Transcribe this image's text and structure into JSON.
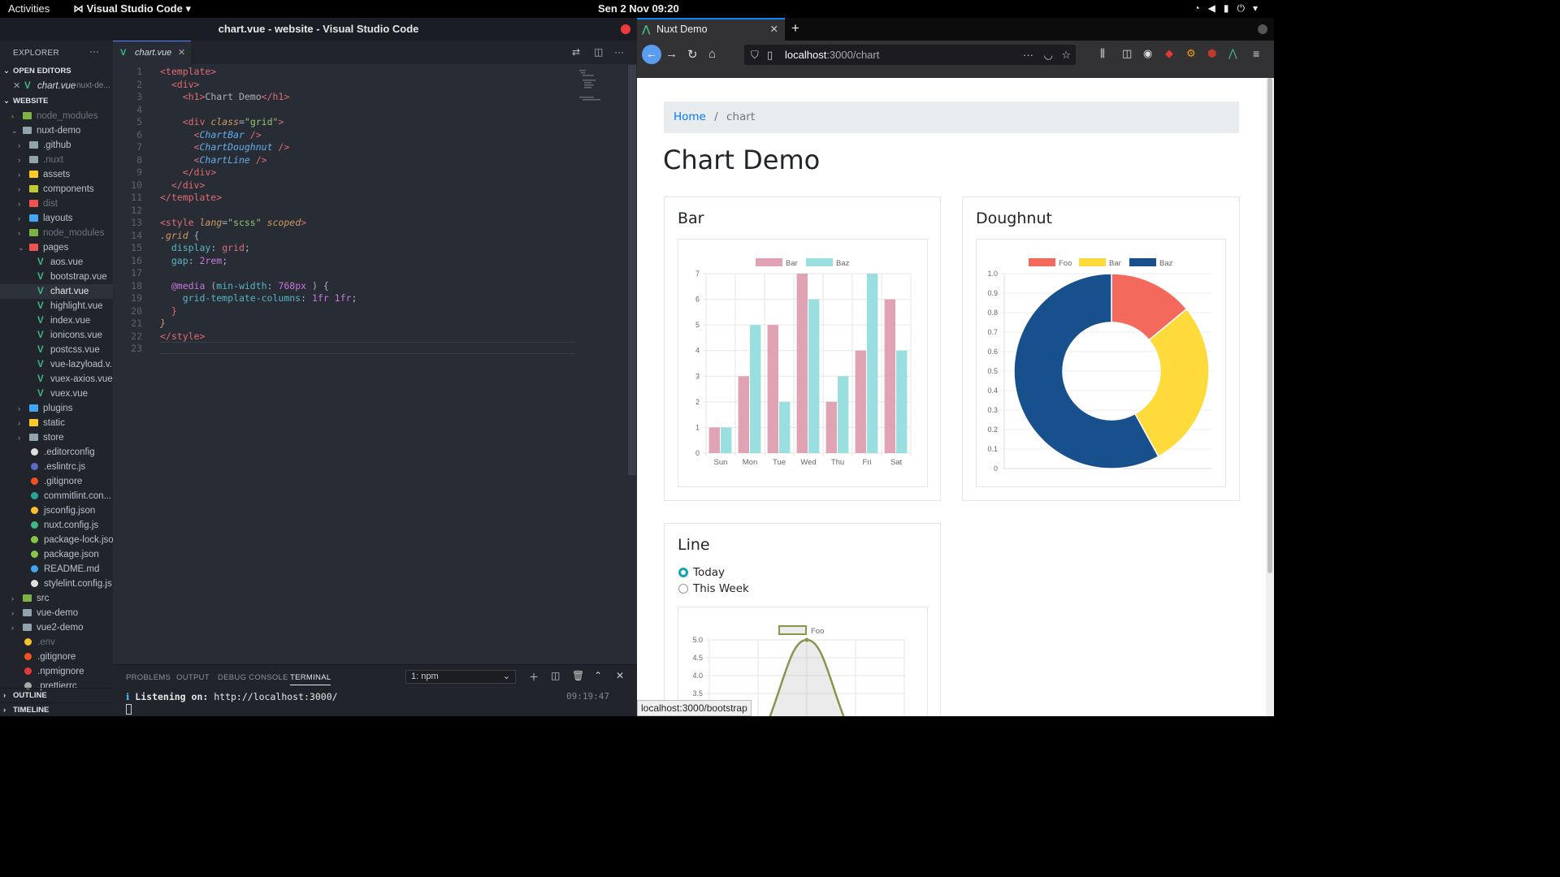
{
  "topbar": {
    "activities": "Activities",
    "app": "Visual Studio Code",
    "clock": "Sen  2 Nov  09:20"
  },
  "vscode": {
    "title": "chart.vue - website - Visual Studio Code",
    "explorer_label": "EXPLORER",
    "open_editors_label": "OPEN EDITORS",
    "open_editor": {
      "name": "chart.vue",
      "folder": "nuxt-de..."
    },
    "website_label": "WEBSITE",
    "outline_label": "OUTLINE",
    "timeline_label": "TIMELINE",
    "tree": [
      {
        "label": "node_modules",
        "depth": 1,
        "kind": "folder",
        "color": "#7cb342",
        "muted": true
      },
      {
        "label": "nuxt-demo",
        "depth": 1,
        "kind": "folder-open",
        "color": "#90a4ae"
      },
      {
        "label": ".github",
        "depth": 2,
        "kind": "folder",
        "color": "#90a4ae"
      },
      {
        "label": ".nuxt",
        "depth": 2,
        "kind": "folder",
        "color": "#90a4ae",
        "muted": true
      },
      {
        "label": "assets",
        "depth": 2,
        "kind": "folder",
        "color": "#ffca28"
      },
      {
        "label": "components",
        "depth": 2,
        "kind": "folder",
        "color": "#c0ca33"
      },
      {
        "label": "dist",
        "depth": 2,
        "kind": "folder",
        "color": "#ef5350",
        "muted": true
      },
      {
        "label": "layouts",
        "depth": 2,
        "kind": "folder",
        "color": "#42a5f5"
      },
      {
        "label": "node_modules",
        "depth": 2,
        "kind": "folder",
        "color": "#7cb342",
        "muted": true
      },
      {
        "label": "pages",
        "depth": 2,
        "kind": "folder-open",
        "color": "#ef5350"
      },
      {
        "label": "aos.vue",
        "depth": 3,
        "kind": "vue"
      },
      {
        "label": "bootstrap.vue",
        "depth": 3,
        "kind": "vue"
      },
      {
        "label": "chart.vue",
        "depth": 3,
        "kind": "vue",
        "selected": true
      },
      {
        "label": "highlight.vue",
        "depth": 3,
        "kind": "vue"
      },
      {
        "label": "index.vue",
        "depth": 3,
        "kind": "vue"
      },
      {
        "label": "ionicons.vue",
        "depth": 3,
        "kind": "vue"
      },
      {
        "label": "postcss.vue",
        "depth": 3,
        "kind": "vue"
      },
      {
        "label": "vue-lazyload.v...",
        "depth": 3,
        "kind": "vue"
      },
      {
        "label": "vuex-axios.vue",
        "depth": 3,
        "kind": "vue"
      },
      {
        "label": "vuex.vue",
        "depth": 3,
        "kind": "vue"
      },
      {
        "label": "plugins",
        "depth": 2,
        "kind": "folder",
        "color": "#42a5f5"
      },
      {
        "label": "static",
        "depth": 2,
        "kind": "folder",
        "color": "#ffca28"
      },
      {
        "label": "store",
        "depth": 2,
        "kind": "folder",
        "color": "#90a4ae"
      },
      {
        "label": ".editorconfig",
        "depth": 2,
        "kind": "file",
        "color": "#e0e0e0"
      },
      {
        "label": ".eslintrc.js",
        "depth": 2,
        "kind": "file",
        "color": "#5c6bc0"
      },
      {
        "label": ".gitignore",
        "depth": 2,
        "kind": "file",
        "color": "#f4511e"
      },
      {
        "label": "commitlint.con...",
        "depth": 2,
        "kind": "file",
        "color": "#26a69a"
      },
      {
        "label": "jsconfig.json",
        "depth": 2,
        "kind": "json",
        "color": "#fbc02d"
      },
      {
        "label": "nuxt.config.js",
        "depth": 2,
        "kind": "file",
        "color": "#41b883"
      },
      {
        "label": "package-lock.json",
        "depth": 2,
        "kind": "file",
        "color": "#8bc34a"
      },
      {
        "label": "package.json",
        "depth": 2,
        "kind": "file",
        "color": "#8bc34a"
      },
      {
        "label": "README.md",
        "depth": 2,
        "kind": "file",
        "color": "#42a5f5"
      },
      {
        "label": "stylelint.config.js",
        "depth": 2,
        "kind": "file",
        "color": "#e0e0e0"
      },
      {
        "label": "src",
        "depth": 1,
        "kind": "folder",
        "color": "#7cb342"
      },
      {
        "label": "vue-demo",
        "depth": 1,
        "kind": "folder",
        "color": "#90a4ae"
      },
      {
        "label": "vue2-demo",
        "depth": 1,
        "kind": "folder",
        "color": "#90a4ae"
      },
      {
        "label": ".env",
        "depth": 1,
        "kind": "file",
        "color": "#fbc02d",
        "muted": true
      },
      {
        "label": ".gitignore",
        "depth": 1,
        "kind": "file",
        "color": "#f4511e"
      },
      {
        "label": ".npmignore",
        "depth": 1,
        "kind": "file",
        "color": "#e53935"
      },
      {
        "label": ".prettierrc",
        "depth": 1,
        "kind": "file",
        "color": "#aaa"
      }
    ],
    "tab": "chart.vue",
    "code": [
      [
        [
          "tg",
          "<template>"
        ]
      ],
      [
        [
          "",
          "  "
        ],
        [
          "tg",
          "<div>"
        ]
      ],
      [
        [
          "",
          "    "
        ],
        [
          "tg",
          "<h1>"
        ],
        [
          "",
          "Chart Demo"
        ],
        [
          "tg",
          "</h1>"
        ]
      ],
      [
        [
          "",
          ""
        ]
      ],
      [
        [
          "",
          "    "
        ],
        [
          "tg",
          "<div "
        ],
        [
          "at",
          "class"
        ],
        [
          "",
          "="
        ],
        [
          "st",
          "\"grid\""
        ],
        [
          "tg",
          ">"
        ]
      ],
      [
        [
          "",
          "      "
        ],
        [
          "tg",
          "<"
        ],
        [
          "it",
          "ChartBar"
        ],
        [
          "tg",
          " />"
        ]
      ],
      [
        [
          "",
          "      "
        ],
        [
          "tg",
          "<"
        ],
        [
          "it",
          "ChartDoughnut"
        ],
        [
          "tg",
          " />"
        ]
      ],
      [
        [
          "",
          "      "
        ],
        [
          "tg",
          "<"
        ],
        [
          "it",
          "ChartLine"
        ],
        [
          "tg",
          " />"
        ]
      ],
      [
        [
          "",
          "    "
        ],
        [
          "tg",
          "</div>"
        ]
      ],
      [
        [
          "",
          "  "
        ],
        [
          "tg",
          "</div>"
        ]
      ],
      [
        [
          "tg",
          "</template>"
        ]
      ],
      [
        [
          "",
          ""
        ]
      ],
      [
        [
          "tg",
          "<style "
        ],
        [
          "at",
          "lang"
        ],
        [
          "",
          "="
        ],
        [
          "st",
          "\"scss\""
        ],
        [
          "at",
          " scoped"
        ],
        [
          "tg",
          ">"
        ]
      ],
      [
        [
          "at",
          ".grid"
        ],
        [
          "",
          " {"
        ]
      ],
      [
        [
          "",
          "  "
        ],
        [
          "pr",
          "display"
        ],
        [
          "",
          ": "
        ],
        [
          "tg",
          "grid"
        ],
        [
          "",
          ";"
        ]
      ],
      [
        [
          "",
          "  "
        ],
        [
          "pr",
          "gap"
        ],
        [
          "",
          ": "
        ],
        [
          "kw",
          "2rem"
        ],
        [
          "",
          ";"
        ]
      ],
      [
        [
          "",
          ""
        ]
      ],
      [
        [
          "",
          "  "
        ],
        [
          "kw",
          "@media"
        ],
        [
          "",
          " ("
        ],
        [
          "pr",
          "min-width"
        ],
        [
          "",
          ": "
        ],
        [
          "kw",
          "768px"
        ],
        [
          "",
          " ) {"
        ]
      ],
      [
        [
          "",
          "    "
        ],
        [
          "pr",
          "grid-template-columns"
        ],
        [
          "",
          ": "
        ],
        [
          "kw",
          "1fr 1fr"
        ],
        [
          "",
          ";"
        ]
      ],
      [
        [
          "",
          "  "
        ],
        [
          "tg",
          "}"
        ]
      ],
      [
        [
          "at",
          "}"
        ]
      ],
      [
        [
          "tg",
          "</style>"
        ]
      ],
      [
        [
          "",
          ""
        ]
      ]
    ],
    "panel_tabs": [
      "PROBLEMS",
      "OUTPUT",
      "DEBUG CONSOLE",
      "TERMINAL"
    ],
    "terminal_select": "1: npm",
    "terminal_line_prefix": "ℹ ",
    "terminal_line_bold": "Listening on: ",
    "terminal_line_url": "http://localhost:3000/",
    "terminal_time": "09:19:47"
  },
  "firefox": {
    "tab_title": "Nuxt Demo",
    "url_host": "localhost",
    "url_path": ":3000/chart",
    "status_url": "localhost:3000/bootstrap"
  },
  "page": {
    "breadcrumb_home": "Home",
    "breadcrumb_sep": "/",
    "breadcrumb_current": "chart",
    "title": "Chart Demo",
    "bar_title": "Bar",
    "doughnut_title": "Doughnut",
    "line_title": "Line",
    "radio_today": "Today",
    "radio_week": "This Week"
  },
  "chart_data": [
    {
      "type": "bar",
      "categories": [
        "Sun",
        "Mon",
        "Tue",
        "Wed",
        "Thu",
        "Fri",
        "Sat"
      ],
      "series": [
        {
          "name": "Bar",
          "values": [
            1,
            3,
            5,
            7,
            2,
            4,
            6
          ],
          "color": "#e0a3b3"
        },
        {
          "name": "Baz",
          "values": [
            1,
            5,
            2,
            6,
            3,
            7,
            4
          ],
          "color": "#99dfe0"
        }
      ],
      "ylim": [
        0,
        7
      ],
      "yticks": [
        0,
        1,
        2,
        3,
        4,
        5,
        6,
        7
      ],
      "legend": "top"
    },
    {
      "type": "pie",
      "labels": [
        "Foo",
        "Bar",
        "Baz"
      ],
      "values": [
        0.14,
        0.28,
        0.58
      ],
      "colors": [
        "#f3695c",
        "#fedb3a",
        "#17508c"
      ],
      "yticks": [
        "1.0",
        "0.9",
        "0.8",
        "0.7",
        "0.6",
        "0.5",
        "0.4",
        "0.3",
        "0.2",
        "0.1",
        "0"
      ],
      "legend": "top"
    },
    {
      "type": "line",
      "series": [
        {
          "name": "Foo",
          "color": "#8a944e"
        }
      ],
      "yticks_visible": [
        "5.0",
        "4.5",
        "4.0",
        "3.5"
      ],
      "peak": 5.0,
      "legend": "top"
    }
  ]
}
